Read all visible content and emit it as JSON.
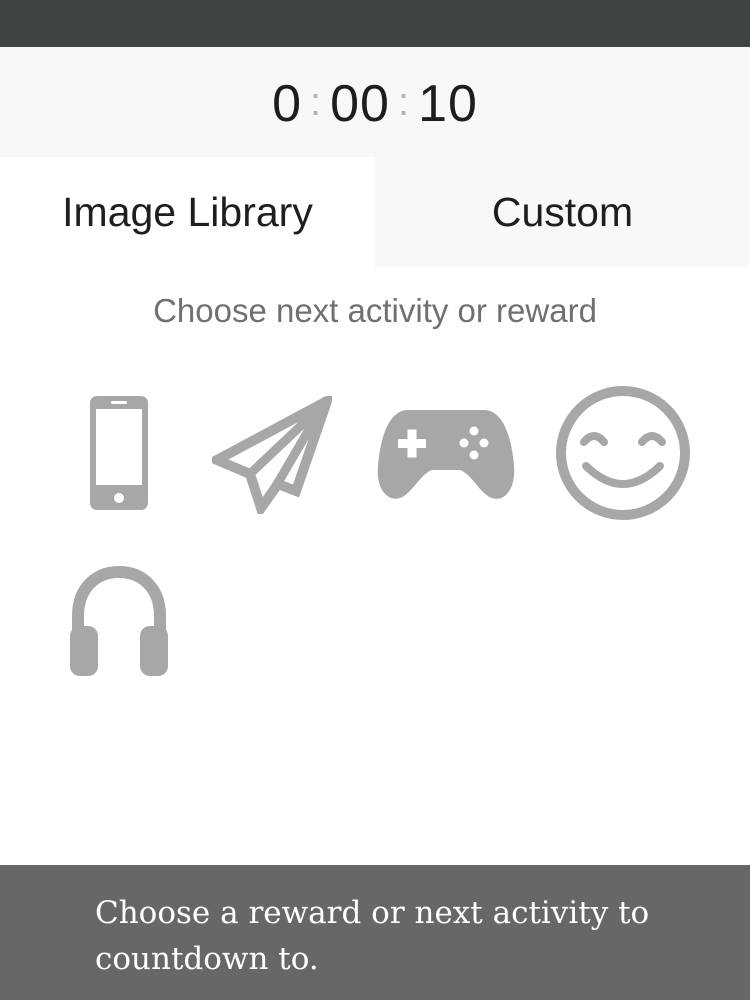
{
  "timer": {
    "hours": "0",
    "minutes": "00",
    "seconds": "10",
    "separator": ":"
  },
  "tabs": {
    "library": "Image Library",
    "custom": "Custom"
  },
  "prompt": "Choose next activity or reward",
  "icons": [
    "phone-icon",
    "paper-plane-icon",
    "game-controller-icon",
    "smiley-face-icon",
    "headphones-icon"
  ],
  "colors": {
    "top_bar": "#3f4545",
    "footer": "#676767",
    "icon": "#a7a7a7",
    "tab_inactive": "#f7f8f9"
  },
  "footer": {
    "message": "Choose a reward or next activity to countdown to."
  }
}
